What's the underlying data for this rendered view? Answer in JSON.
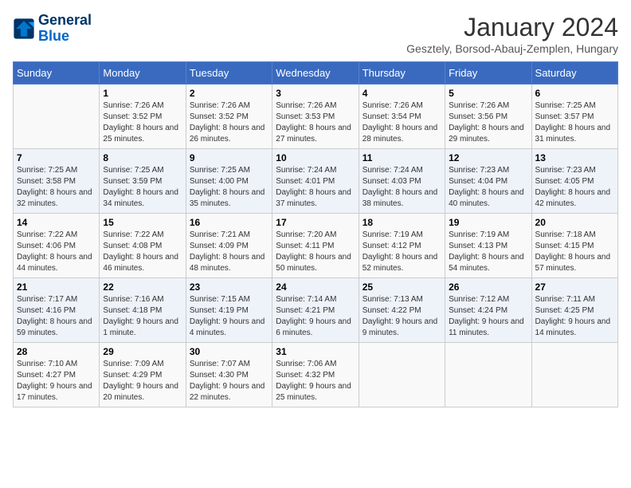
{
  "header": {
    "logo_line1": "General",
    "logo_line2": "Blue",
    "month_title": "January 2024",
    "location": "Gesztely, Borsod-Abauj-Zemplen, Hungary"
  },
  "days_of_week": [
    "Sunday",
    "Monday",
    "Tuesday",
    "Wednesday",
    "Thursday",
    "Friday",
    "Saturday"
  ],
  "weeks": [
    [
      {
        "num": "",
        "info": ""
      },
      {
        "num": "1",
        "info": "Sunrise: 7:26 AM\nSunset: 3:52 PM\nDaylight: 8 hours and 25 minutes."
      },
      {
        "num": "2",
        "info": "Sunrise: 7:26 AM\nSunset: 3:52 PM\nDaylight: 8 hours and 26 minutes."
      },
      {
        "num": "3",
        "info": "Sunrise: 7:26 AM\nSunset: 3:53 PM\nDaylight: 8 hours and 27 minutes."
      },
      {
        "num": "4",
        "info": "Sunrise: 7:26 AM\nSunset: 3:54 PM\nDaylight: 8 hours and 28 minutes."
      },
      {
        "num": "5",
        "info": "Sunrise: 7:26 AM\nSunset: 3:56 PM\nDaylight: 8 hours and 29 minutes."
      },
      {
        "num": "6",
        "info": "Sunrise: 7:25 AM\nSunset: 3:57 PM\nDaylight: 8 hours and 31 minutes."
      }
    ],
    [
      {
        "num": "7",
        "info": "Sunrise: 7:25 AM\nSunset: 3:58 PM\nDaylight: 8 hours and 32 minutes."
      },
      {
        "num": "8",
        "info": "Sunrise: 7:25 AM\nSunset: 3:59 PM\nDaylight: 8 hours and 34 minutes."
      },
      {
        "num": "9",
        "info": "Sunrise: 7:25 AM\nSunset: 4:00 PM\nDaylight: 8 hours and 35 minutes."
      },
      {
        "num": "10",
        "info": "Sunrise: 7:24 AM\nSunset: 4:01 PM\nDaylight: 8 hours and 37 minutes."
      },
      {
        "num": "11",
        "info": "Sunrise: 7:24 AM\nSunset: 4:03 PM\nDaylight: 8 hours and 38 minutes."
      },
      {
        "num": "12",
        "info": "Sunrise: 7:23 AM\nSunset: 4:04 PM\nDaylight: 8 hours and 40 minutes."
      },
      {
        "num": "13",
        "info": "Sunrise: 7:23 AM\nSunset: 4:05 PM\nDaylight: 8 hours and 42 minutes."
      }
    ],
    [
      {
        "num": "14",
        "info": "Sunrise: 7:22 AM\nSunset: 4:06 PM\nDaylight: 8 hours and 44 minutes."
      },
      {
        "num": "15",
        "info": "Sunrise: 7:22 AM\nSunset: 4:08 PM\nDaylight: 8 hours and 46 minutes."
      },
      {
        "num": "16",
        "info": "Sunrise: 7:21 AM\nSunset: 4:09 PM\nDaylight: 8 hours and 48 minutes."
      },
      {
        "num": "17",
        "info": "Sunrise: 7:20 AM\nSunset: 4:11 PM\nDaylight: 8 hours and 50 minutes."
      },
      {
        "num": "18",
        "info": "Sunrise: 7:19 AM\nSunset: 4:12 PM\nDaylight: 8 hours and 52 minutes."
      },
      {
        "num": "19",
        "info": "Sunrise: 7:19 AM\nSunset: 4:13 PM\nDaylight: 8 hours and 54 minutes."
      },
      {
        "num": "20",
        "info": "Sunrise: 7:18 AM\nSunset: 4:15 PM\nDaylight: 8 hours and 57 minutes."
      }
    ],
    [
      {
        "num": "21",
        "info": "Sunrise: 7:17 AM\nSunset: 4:16 PM\nDaylight: 8 hours and 59 minutes."
      },
      {
        "num": "22",
        "info": "Sunrise: 7:16 AM\nSunset: 4:18 PM\nDaylight: 9 hours and 1 minute."
      },
      {
        "num": "23",
        "info": "Sunrise: 7:15 AM\nSunset: 4:19 PM\nDaylight: 9 hours and 4 minutes."
      },
      {
        "num": "24",
        "info": "Sunrise: 7:14 AM\nSunset: 4:21 PM\nDaylight: 9 hours and 6 minutes."
      },
      {
        "num": "25",
        "info": "Sunrise: 7:13 AM\nSunset: 4:22 PM\nDaylight: 9 hours and 9 minutes."
      },
      {
        "num": "26",
        "info": "Sunrise: 7:12 AM\nSunset: 4:24 PM\nDaylight: 9 hours and 11 minutes."
      },
      {
        "num": "27",
        "info": "Sunrise: 7:11 AM\nSunset: 4:25 PM\nDaylight: 9 hours and 14 minutes."
      }
    ],
    [
      {
        "num": "28",
        "info": "Sunrise: 7:10 AM\nSunset: 4:27 PM\nDaylight: 9 hours and 17 minutes."
      },
      {
        "num": "29",
        "info": "Sunrise: 7:09 AM\nSunset: 4:29 PM\nDaylight: 9 hours and 20 minutes."
      },
      {
        "num": "30",
        "info": "Sunrise: 7:07 AM\nSunset: 4:30 PM\nDaylight: 9 hours and 22 minutes."
      },
      {
        "num": "31",
        "info": "Sunrise: 7:06 AM\nSunset: 4:32 PM\nDaylight: 9 hours and 25 minutes."
      },
      {
        "num": "",
        "info": ""
      },
      {
        "num": "",
        "info": ""
      },
      {
        "num": "",
        "info": ""
      }
    ]
  ]
}
